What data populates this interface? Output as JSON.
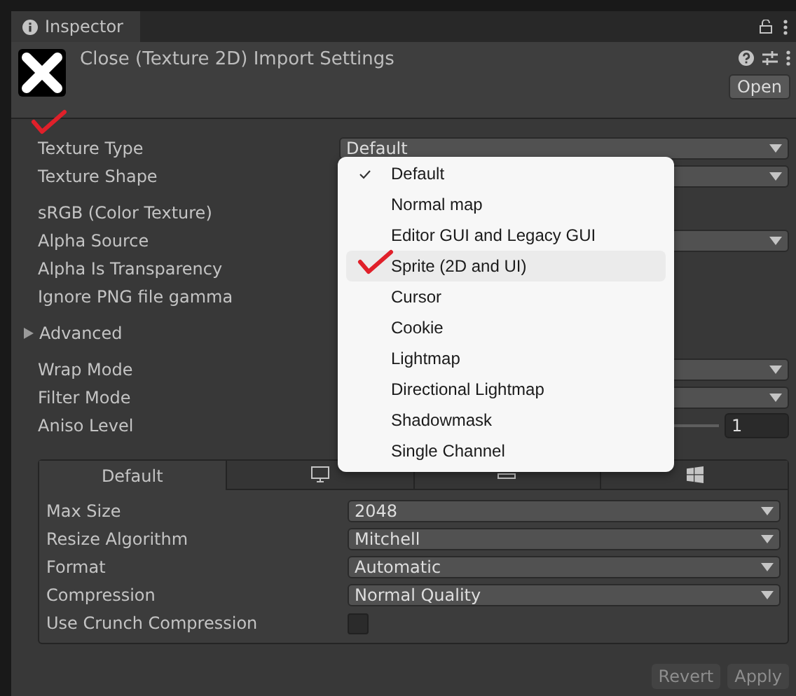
{
  "tab": {
    "label": "Inspector"
  },
  "header": {
    "title": "Close (Texture 2D) Import Settings",
    "open_button": "Open"
  },
  "groups": [
    [
      {
        "label": "Texture Type",
        "kind": "dropdown",
        "value": "Default",
        "marked": true
      },
      {
        "label": "Texture Shape",
        "kind": "dropdown",
        "marked": false
      }
    ],
    [
      {
        "label": "sRGB (Color Texture)",
        "kind": "hidden",
        "marked": false
      },
      {
        "label": "Alpha Source",
        "kind": "dropdown",
        "marked": false
      },
      {
        "label": "Alpha Is Transparency",
        "kind": "hidden",
        "marked": false
      },
      {
        "label": "Ignore PNG file gamma",
        "kind": "hidden",
        "marked": false
      }
    ],
    [
      {
        "label": "Advanced",
        "kind": "foldout",
        "expanded": false,
        "marked": false
      }
    ],
    [
      {
        "label": "Wrap Mode",
        "kind": "dropdown",
        "marked": false
      },
      {
        "label": "Filter Mode",
        "kind": "dropdown",
        "marked": false
      },
      {
        "label": "Aniso Level",
        "kind": "slider",
        "value": "1",
        "marked": false
      }
    ]
  ],
  "platform_tabs": [
    {
      "kind": "text",
      "label": "Default",
      "selected": true
    },
    {
      "kind": "monitor",
      "selected": false
    },
    {
      "kind": "android",
      "selected": false
    },
    {
      "kind": "windows",
      "selected": false
    }
  ],
  "platform_rows": [
    {
      "label": "Max Size",
      "kind": "dropdown",
      "value": "2048"
    },
    {
      "label": "Resize Algorithm",
      "kind": "dropdown",
      "value": "Mitchell"
    },
    {
      "label": "Format",
      "kind": "dropdown",
      "value": "Automatic"
    },
    {
      "label": "Compression",
      "kind": "dropdown",
      "value": "Normal Quality"
    },
    {
      "label": "Use Crunch Compression",
      "kind": "checkbox",
      "checked": false
    }
  ],
  "buttons": [
    "Revert",
    "Apply"
  ],
  "dropdown_menu": [
    {
      "label": "Default",
      "checked": true,
      "hovered": false,
      "marked": false
    },
    {
      "label": "Normal map",
      "checked": false,
      "hovered": false,
      "marked": false
    },
    {
      "label": "Editor GUI and Legacy GUI",
      "checked": false,
      "hovered": false,
      "marked": false
    },
    {
      "label": "Sprite (2D and UI)",
      "checked": false,
      "hovered": true,
      "marked": true
    },
    {
      "label": "Cursor",
      "checked": false,
      "hovered": false,
      "marked": false
    },
    {
      "label": "Cookie",
      "checked": false,
      "hovered": false,
      "marked": false
    },
    {
      "label": "Lightmap",
      "checked": false,
      "hovered": false,
      "marked": false
    },
    {
      "label": "Directional Lightmap",
      "checked": false,
      "hovered": false,
      "marked": false
    },
    {
      "label": "Shadowmask",
      "checked": false,
      "hovered": false,
      "marked": false
    },
    {
      "label": "Single Channel",
      "checked": false,
      "hovered": false,
      "marked": false
    }
  ]
}
